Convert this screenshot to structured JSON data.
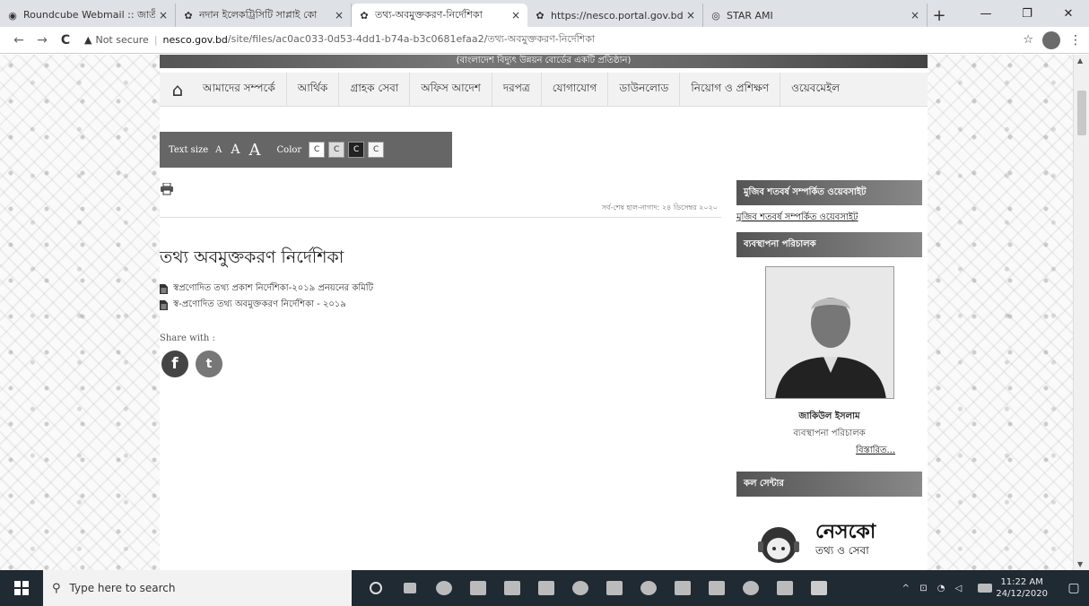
{
  "browser": {
    "tabs": [
      {
        "title": "Roundcube Webmail :: জাতীয়",
        "icon": "roundcube-icon",
        "active": false
      },
      {
        "title": "নদান ইলেকট্রিসিটি সাপ্লাই কো",
        "icon": "site-icon",
        "active": false
      },
      {
        "title": "তথ্য-অবমুক্তকরণ-নির্দেশিকা",
        "icon": "site-icon",
        "active": true
      },
      {
        "title": "https://nesco.portal.gov.bd/",
        "icon": "site-icon",
        "active": false
      },
      {
        "title": "STAR AMI",
        "icon": "globe-icon",
        "active": false
      }
    ],
    "tab_close": "×",
    "new_tab": "+",
    "window": {
      "minimize": "—",
      "maximize": "❐",
      "close": "✕"
    },
    "nav": {
      "back": "←",
      "forward": "→",
      "reload": "C"
    },
    "address": {
      "warning": "▲",
      "security_label": "Not secure",
      "separator": "|",
      "host": "nesco.gov.bd",
      "path": "/site/files/ac0ac033-0d53-4dd1-b74a-b3c0681efaa2/তথ্য-অবমুক্তকরণ-নির্দেশিকা"
    },
    "star": "☆",
    "menu": "⋮"
  },
  "site": {
    "banner_text": "(বাংলাদেশ বিদ্যুৎ উন্নয়ন বোর্ডের একটি প্রতিষ্ঠান)",
    "nav_items": [
      "আমাদের সম্পর্কে",
      "আর্থিক",
      "গ্রাহক সেবা",
      "অফিস আদেশ",
      "দরপত্র",
      "যোগাযোগ",
      "ডাউনলোড",
      "নিয়োগ ও প্রশিক্ষণ",
      "ওয়েবমেইল"
    ],
    "home_glyph": "⌂",
    "accessibility": {
      "text_size_label": "Text size",
      "size_small": "A",
      "size_medium": "A",
      "size_large": "A",
      "color_label": "Color",
      "swatches": [
        "C",
        "C",
        "C",
        "C"
      ]
    },
    "updated": "সর্ব-শেষ হাল-নাগাদ: ২৪ ডিসেম্বর ২০২০",
    "content_title": "তথ্য অবমুক্তকরণ নির্দেশিকা",
    "documents": [
      "স্বপ্রণোদিত তথ্য প্রকাশ নির্দেশিকা-২০১৯ প্রনয়নের কমিটি",
      "স্ব-প্রণোদিত তথ্য অবমুক্তকরণ নির্দেশিকা - ২০১৯"
    ],
    "share_label": "Share with :",
    "share_fb": "f",
    "share_tw": "t",
    "sidebar": {
      "mujib_heading": "মুজিব শতবর্ষ সম্পর্কিত ওয়েবসাইট",
      "mujib_link": "মুজিব শতবর্ষ সম্পর্কিত ওয়েবসাইট",
      "md_heading": "ব্যবস্থাপনা পরিচালক",
      "md_name": "জাকিউল ইসলাম",
      "md_role": "ব্যবস্থাপনা পরিচালক",
      "md_more": "বিস্তারিত...",
      "call_heading": "কল সেন্টার",
      "call_brand": "নেসকো",
      "call_sub": "তথ্য ও সেবা"
    }
  },
  "taskbar": {
    "search_placeholder": "Type here to search",
    "search_glyph": "⚲",
    "tray_glyphs": "^ ⊡ ◔ ◁",
    "time": "11:22 AM",
    "date": "24/12/2020",
    "notif_glyph": "▢"
  }
}
